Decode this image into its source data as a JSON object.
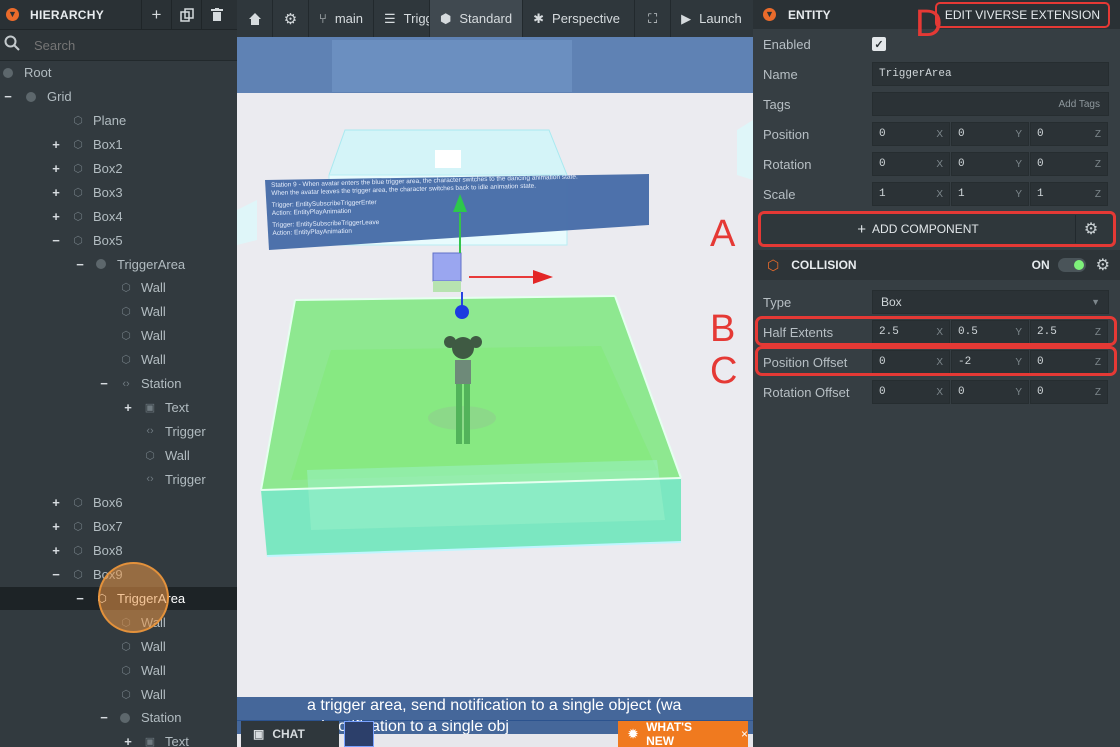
{
  "hierarchy": {
    "title": "HIERARCHY",
    "search_placeholder": "Search",
    "items": [
      {
        "label": "Root",
        "depth": 0,
        "icon": "dot",
        "toggle": ""
      },
      {
        "label": "Grid",
        "depth": 0,
        "icon": "dot",
        "toggle": "−"
      },
      {
        "label": "Plane",
        "depth": 2,
        "icon": "entity",
        "toggle": ""
      },
      {
        "label": "Box1",
        "depth": 2,
        "icon": "entity",
        "toggle": "+"
      },
      {
        "label": "Box2",
        "depth": 2,
        "icon": "entity",
        "toggle": "+"
      },
      {
        "label": "Box3",
        "depth": 2,
        "icon": "entity",
        "toggle": "+"
      },
      {
        "label": "Box4",
        "depth": 2,
        "icon": "entity",
        "toggle": "+"
      },
      {
        "label": "Box5",
        "depth": 2,
        "icon": "entity",
        "toggle": "−"
      },
      {
        "label": "TriggerArea",
        "depth": 3,
        "icon": "dot",
        "toggle": "−"
      },
      {
        "label": "Wall",
        "depth": 4,
        "icon": "entity",
        "toggle": ""
      },
      {
        "label": "Wall",
        "depth": 4,
        "icon": "entity",
        "toggle": ""
      },
      {
        "label": "Wall",
        "depth": 4,
        "icon": "entity",
        "toggle": ""
      },
      {
        "label": "Wall",
        "depth": 4,
        "icon": "entity",
        "toggle": ""
      },
      {
        "label": "Station",
        "depth": 4,
        "icon": "code",
        "toggle": "−"
      },
      {
        "label": "Text",
        "depth": 5,
        "icon": "square",
        "toggle": "+"
      },
      {
        "label": "Trigger",
        "depth": 5,
        "icon": "code",
        "toggle": ""
      },
      {
        "label": "Wall",
        "depth": 5,
        "icon": "entity",
        "toggle": ""
      },
      {
        "label": "Trigger",
        "depth": 5,
        "icon": "code",
        "toggle": ""
      },
      {
        "label": "Box6",
        "depth": 2,
        "icon": "entity",
        "toggle": "+"
      },
      {
        "label": "Box7",
        "depth": 2,
        "icon": "entity",
        "toggle": "+"
      },
      {
        "label": "Box8",
        "depth": 2,
        "icon": "entity",
        "toggle": "+"
      },
      {
        "label": "Box9",
        "depth": 2,
        "icon": "entity",
        "toggle": "−"
      },
      {
        "label": "TriggerArea",
        "depth": 3,
        "icon": "cube",
        "toggle": "−",
        "selected": true
      },
      {
        "label": "Wall",
        "depth": 4,
        "icon": "entity",
        "toggle": ""
      },
      {
        "label": "Wall",
        "depth": 4,
        "icon": "entity",
        "toggle": ""
      },
      {
        "label": "Wall",
        "depth": 4,
        "icon": "entity",
        "toggle": ""
      },
      {
        "label": "Wall",
        "depth": 4,
        "icon": "entity",
        "toggle": ""
      },
      {
        "label": "Station",
        "depth": 4,
        "icon": "dot",
        "toggle": "−"
      },
      {
        "label": "Text",
        "depth": 5,
        "icon": "square",
        "toggle": "+"
      }
    ]
  },
  "toolbar": {
    "branch": "main",
    "scene": "Trigger",
    "mode": "Standard",
    "camera": "Perspective",
    "launch": "Launch"
  },
  "viewport": {
    "panel_text_lines": [
      "Station 9 - When avatar enters the blue trigger area, the character switches to the dancing animation state.",
      "When the avatar leaves the trigger area, the character switches back to idle animation state.",
      "Trigger: EntitySubscribeTriggerEnter",
      "Action: EntityPlayAnimation",
      "Trigger: EntitySubscribeTriggerLeave",
      "Action: EntityPlayAnimation"
    ],
    "bottom_line1": "a trigger area, send notification to a single object (wa",
    "bottom_line2": "nd notification to a single obj",
    "chat": "CHAT",
    "whats_new": "WHAT'S NEW",
    "close": "×"
  },
  "inspector": {
    "title": "ENTITY",
    "edit_button": "EDIT VIVERSE EXTENSION",
    "enabled_label": "Enabled",
    "name_label": "Name",
    "name_value": "TriggerArea",
    "tags_label": "Tags",
    "tags_placeholder": "Add Tags",
    "position": {
      "label": "Position",
      "x": "0",
      "y": "0",
      "z": "0"
    },
    "rotation": {
      "label": "Rotation",
      "x": "0",
      "y": "0",
      "z": "0"
    },
    "scale": {
      "label": "Scale",
      "x": "1",
      "y": "1",
      "z": "1"
    },
    "add_component": "ADD COMPONENT",
    "collision": {
      "title": "COLLISION",
      "state": "ON",
      "type_label": "Type",
      "type_value": "Box",
      "half_extents": {
        "label": "Half Extents",
        "x": "2.5",
        "y": "0.5",
        "z": "2.5"
      },
      "position_offset": {
        "label": "Position Offset",
        "x": "0",
        "y": "-2",
        "z": "0"
      },
      "rotation_offset": {
        "label": "Rotation Offset",
        "x": "0",
        "y": "0",
        "z": "0"
      }
    },
    "axis_labels": {
      "x": "X",
      "y": "Y",
      "z": "Z"
    }
  },
  "annotations": {
    "a": "A",
    "b": "B",
    "c": "C",
    "d": "D"
  },
  "colors": {
    "accent": "#ea6b2b",
    "annotation_red": "#e53935",
    "trigger_green": "#5ef0a0"
  }
}
